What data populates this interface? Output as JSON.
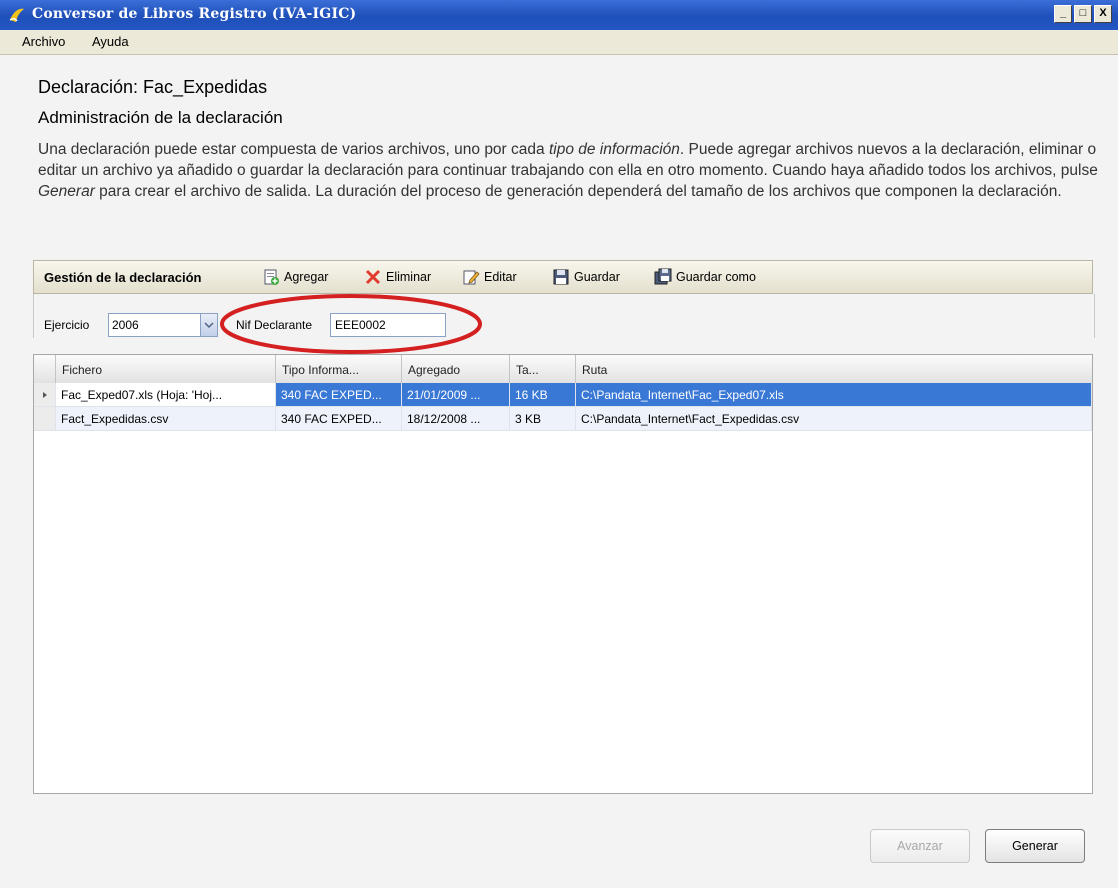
{
  "window": {
    "title": "Conversor de Libros Registro (IVA-IGIC)",
    "min": "_",
    "max": "□",
    "close": "X"
  },
  "menu": [
    "Archivo",
    "Ayuda"
  ],
  "page": {
    "declaration_title": "Declaración: Fac_Expedidas",
    "admin_title": "Administración de la declaración",
    "description_1": "Una declaración puede estar compuesta de varios archivos, uno por cada ",
    "description_tipo": "tipo de información",
    "description_2": ". Puede agregar archivos nuevos a la declaración, eliminar o editar un archivo ya añadido o guardar la declaración para continuar trabajando con ella en otro momento. Cuando haya añadido todos los archivos, pulse ",
    "description_generar": "Generar",
    "description_3": " para crear el archivo de salida. La duración del proceso de generación dependerá del tamaño de los archivos que componen la declaración."
  },
  "toolbar": {
    "title": "Gestión de la declaración",
    "agregar": "Agregar",
    "eliminar": "Eliminar",
    "editar": "Editar",
    "guardar": "Guardar",
    "guardar_como": "Guardar como"
  },
  "params": {
    "ejercicio_label": "Ejercicio",
    "ejercicio_value": "2006",
    "nif_label": "Nif Declarante",
    "nif_value": "EEE0002"
  },
  "grid": {
    "headers": [
      "Fichero",
      "Tipo Informa...",
      "Agregado",
      "Ta...",
      "Ruta"
    ],
    "rows": [
      [
        "Fac_Exped07.xls (Hoja: 'Hoj...",
        "340 FAC EXPED...",
        "21/01/2009 ...",
        "16 KB",
        "C:\\Pandata_Internet\\Fac_Exped07.xls"
      ],
      [
        "Fact_Expedidas.csv",
        "340 FAC EXPED...",
        "18/12/2008 ...",
        "3 KB",
        "C:\\Pandata_Internet\\Fact_Expedidas.csv"
      ]
    ],
    "selected_row": 0
  },
  "buttons": {
    "avanzar": "Avanzar",
    "generar": "Generar"
  },
  "colors": {
    "titlebar": "#1f4fb8",
    "selection": "#3a78d6",
    "highlight_ellipse": "#d42020"
  }
}
